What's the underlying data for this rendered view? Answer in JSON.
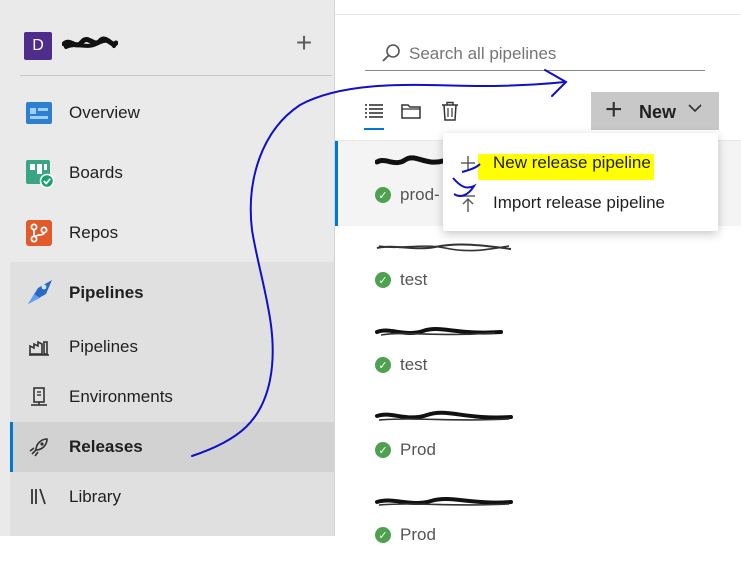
{
  "org": {
    "avatar_letter": "D"
  },
  "sidebar": {
    "items": [
      {
        "label": "Overview"
      },
      {
        "label": "Boards"
      },
      {
        "label": "Repos"
      },
      {
        "label": "Pipelines"
      }
    ],
    "pipelines_sub": [
      {
        "label": "Pipelines"
      },
      {
        "label": "Environments"
      },
      {
        "label": "Releases"
      },
      {
        "label": "Library"
      }
    ]
  },
  "search": {
    "placeholder": "Search all pipelines"
  },
  "toolbar": {
    "new_label": "New"
  },
  "menu": {
    "items": [
      {
        "label": "New release pipeline"
      },
      {
        "label": "Import release pipeline"
      }
    ]
  },
  "list": {
    "rows": [
      {
        "status": "prod-"
      },
      {
        "status": "test"
      },
      {
        "status": "test"
      },
      {
        "status": "Prod"
      },
      {
        "status": "Prod"
      }
    ]
  },
  "colors": {
    "accent": "#0078d4",
    "success": "#4ea14e",
    "highlight": "#ffff00",
    "annotation": "#1010c8"
  }
}
